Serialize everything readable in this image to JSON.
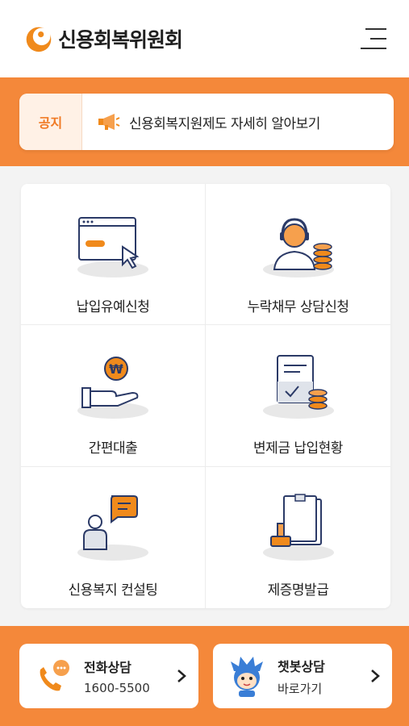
{
  "header": {
    "logo_text": "신용회복위원회",
    "logo_icon": "org-logo-icon",
    "menu_icon": "hamburger-menu-icon"
  },
  "notice": {
    "tag": "공지",
    "icon": "megaphone-icon",
    "text": "신용회복지원제도 자세히 알아보기"
  },
  "services": [
    {
      "label": "납입유예신청",
      "icon": "browser-click-icon"
    },
    {
      "label": "누락채무 상담신청",
      "icon": "headset-agent-coins-icon"
    },
    {
      "label": "간편대출",
      "icon": "hand-won-coin-icon"
    },
    {
      "label": "변제금 납입현황",
      "icon": "document-coins-icon"
    },
    {
      "label": "신용복지 컨설팅",
      "icon": "person-chat-icon"
    },
    {
      "label": "제증명발급",
      "icon": "certificate-stamp-icon"
    }
  ],
  "contacts": {
    "phone": {
      "title": "전화상담",
      "sub": "1600-5500",
      "icon": "phone-chat-icon"
    },
    "chatbot": {
      "title": "챗봇상담",
      "sub": "바로가기",
      "icon": "chatbot-mascot-icon"
    }
  },
  "colors": {
    "accent": "#f4883a",
    "tag_bg": "#fff1e6",
    "tag_text": "#f07a25",
    "navy": "#2b3a67"
  }
}
